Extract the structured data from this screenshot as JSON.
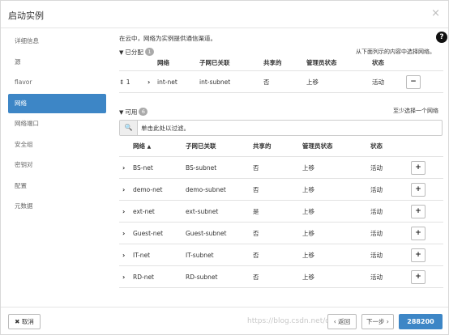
{
  "modal": {
    "title": "启动实例",
    "close": "×"
  },
  "sidebar": {
    "items": [
      {
        "label": "详细信息",
        "active": false
      },
      {
        "label": "源",
        "active": false
      },
      {
        "label": "flavor",
        "active": false
      },
      {
        "label": "网络",
        "active": true
      },
      {
        "label": "网络端口",
        "active": false
      },
      {
        "label": "安全组",
        "active": false
      },
      {
        "label": "密钥对",
        "active": false
      },
      {
        "label": "配置",
        "active": false
      },
      {
        "label": "元数据",
        "active": false
      }
    ]
  },
  "help": "?",
  "description": "在云中，网络为实例提供通信渠道。",
  "allocated": {
    "label": "已分配",
    "count": "1",
    "note": "从下面列示的内容中选择网络。",
    "headers": [
      "网络",
      "子网已关联",
      "共享的",
      "管理员状态",
      "状态"
    ],
    "rows": [
      {
        "order": "1",
        "network": "int-net",
        "subnet": "int-subnet",
        "shared": "否",
        "admin": "上移",
        "status": "活动",
        "action": "−"
      }
    ]
  },
  "available": {
    "label": "可用",
    "count": "6",
    "note": "至少选择一个网络",
    "search_placeholder": "单击此处以过滤。",
    "headers": [
      "网络",
      "子网已关联",
      "共享的",
      "管理员状态",
      "状态"
    ],
    "sort_indicator": "▲",
    "rows": [
      {
        "network": "BS-net",
        "subnet": "BS-subnet",
        "shared": "否",
        "admin": "上移",
        "status": "活动",
        "action": "+"
      },
      {
        "network": "demo-net",
        "subnet": "demo-subnet",
        "shared": "否",
        "admin": "上移",
        "status": "活动",
        "action": "+"
      },
      {
        "network": "ext-net",
        "subnet": "ext-subnet",
        "shared": "是",
        "admin": "上移",
        "status": "活动",
        "action": "+"
      },
      {
        "network": "Guest-net",
        "subnet": "Guest-subnet",
        "shared": "否",
        "admin": "上移",
        "status": "活动",
        "action": "+"
      },
      {
        "network": "IT-net",
        "subnet": "IT-subnet",
        "shared": "否",
        "admin": "上移",
        "status": "活动",
        "action": "+"
      },
      {
        "network": "RD-net",
        "subnet": "RD-subnet",
        "shared": "否",
        "admin": "上移",
        "status": "活动",
        "action": "+"
      }
    ]
  },
  "footer": {
    "cancel": "✖ 取消",
    "back": "‹ 返回",
    "next": "下一步 ›",
    "launch": "288200",
    "watermark": "https://blog.csdn.net/qq_36"
  },
  "colors": {
    "accent": "#3d86c6",
    "badge": "#aaaaaa"
  }
}
